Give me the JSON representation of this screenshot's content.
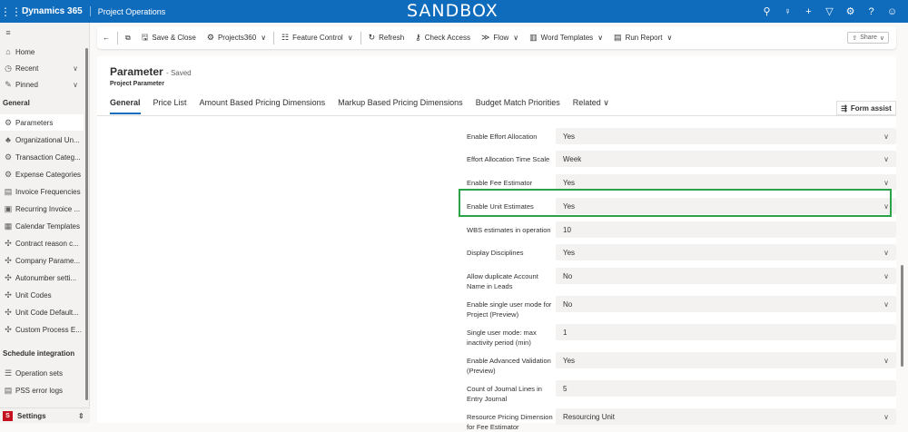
{
  "topbar": {
    "app": "Dynamics 365",
    "area": "Project Operations",
    "env": "SANDBOX"
  },
  "nav": {
    "top": [
      {
        "label": "Home"
      },
      {
        "label": "Recent"
      },
      {
        "label": "Pinned"
      }
    ],
    "section1": "General",
    "items": [
      {
        "label": "Parameters"
      },
      {
        "label": "Organizational Un..."
      },
      {
        "label": "Transaction Categ..."
      },
      {
        "label": "Expense Categories"
      },
      {
        "label": "Invoice Frequencies"
      },
      {
        "label": "Recurring Invoice ..."
      },
      {
        "label": "Calendar Templates"
      },
      {
        "label": "Contract reason c..."
      },
      {
        "label": "Company Parame..."
      },
      {
        "label": "Autonumber setti..."
      },
      {
        "label": "Unit Codes"
      },
      {
        "label": "Unit Code Default..."
      },
      {
        "label": "Custom Process E..."
      }
    ],
    "section2": "Schedule integration",
    "items2": [
      {
        "label": "Operation sets"
      },
      {
        "label": "PSS error logs"
      }
    ],
    "settings": "Settings",
    "settings_badge": "S"
  },
  "toolbar": {
    "save_close": "Save & Close",
    "projects360": "Projects360",
    "feature_control": "Feature Control",
    "refresh": "Refresh",
    "check_access": "Check Access",
    "flow": "Flow",
    "word_templates": "Word Templates",
    "run_report": "Run Report",
    "share": "Share"
  },
  "header": {
    "title": "Parameter",
    "saved": "- Saved",
    "entity": "Project Parameter",
    "tabs": [
      "General",
      "Price List",
      "Amount Based Pricing Dimensions",
      "Markup Based Pricing Dimensions",
      "Budget Match Priorities",
      "Related"
    ],
    "form_assist": "Form assist"
  },
  "fields": [
    {
      "label": "Enable Effort Allocation",
      "value": "Yes"
    },
    {
      "label": "Effort Allocation Time Scale",
      "value": "Week"
    },
    {
      "label": "Enable Fee Estimator",
      "value": "Yes"
    },
    {
      "label": "Enable Unit Estimates",
      "value": "Yes"
    },
    {
      "label": "WBS estimates in operation",
      "value": "10"
    },
    {
      "label": "Display Disciplines",
      "value": "Yes"
    },
    {
      "label": "Allow duplicate Account Name in Leads",
      "value": "No"
    },
    {
      "label": "Enable single user mode for Project (Preview)",
      "value": "No"
    },
    {
      "label": "Single user mode: max inactivity period (min)",
      "value": "1"
    },
    {
      "label": "Enable Advanced Validation (Preview)",
      "value": "Yes"
    },
    {
      "label": "Count of Journal Lines in Entry Journal",
      "value": "5"
    },
    {
      "label": "Resource Pricing Dimension for Fee Estimator",
      "value": "Resourcing Unit"
    }
  ],
  "colors": {
    "brand": "#0f6cbd",
    "highlight": "#2ba348"
  }
}
